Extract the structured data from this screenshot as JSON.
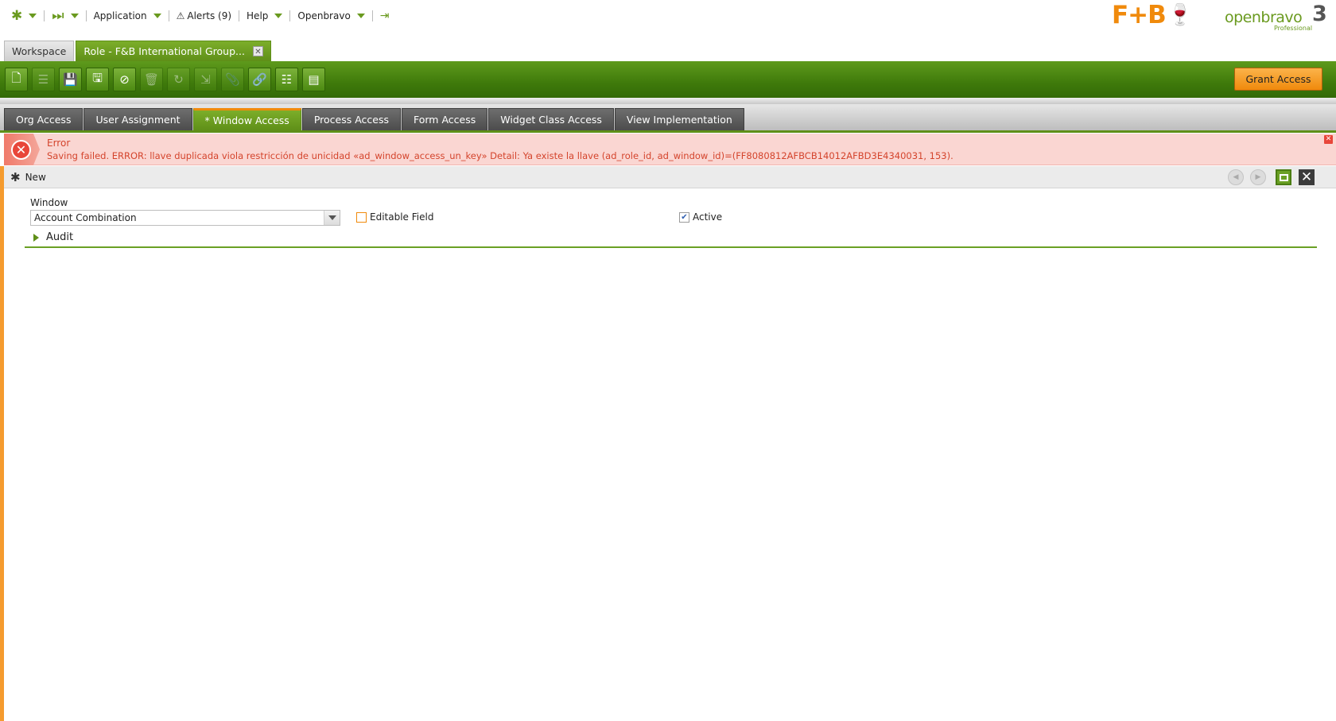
{
  "topnav": {
    "application": "Application",
    "alerts": "Alerts (9)",
    "help": "Help",
    "openbravo": "Openbravo"
  },
  "logos": {
    "fb": "F+B",
    "ob_word": "openbravo",
    "ob_version": "3",
    "ob_edition": "Professional"
  },
  "main_tabs": [
    {
      "label": "Workspace"
    },
    {
      "label": "Role - F&B International Group..."
    }
  ],
  "toolbar": {
    "grant_access": "Grant Access",
    "buttons": [
      "new-document",
      "new-row",
      "save",
      "save-close",
      "undo",
      "delete",
      "refresh",
      "export",
      "attach",
      "link",
      "tree",
      "grid-form-toggle"
    ]
  },
  "child_tabs": [
    {
      "label": "Org Access"
    },
    {
      "label": "User Assignment"
    },
    {
      "label": "* Window Access"
    },
    {
      "label": "Process Access"
    },
    {
      "label": "Form Access"
    },
    {
      "label": "Widget Class Access"
    },
    {
      "label": "View Implementation"
    }
  ],
  "error": {
    "title": "Error",
    "message": "Saving failed. ERROR: llave duplicada viola restricción de unicidad «ad_window_access_un_key» Detail: Ya existe la llave (ad_role_id, ad_window_id)=(FF8080812AFBCB14012AFBD3E4340031, 153)."
  },
  "form": {
    "status": "New",
    "window_label": "Window",
    "window_value": "Account Combination",
    "editable_field_label": "Editable Field",
    "editable_field_checked": false,
    "active_label": "Active",
    "active_checked": true,
    "audit_label": "Audit"
  },
  "colors": {
    "brand_green": "#5f8f18",
    "accent_orange": "#f08a0c",
    "error_red": "#d4442c",
    "error_bg": "#fad6d2"
  }
}
